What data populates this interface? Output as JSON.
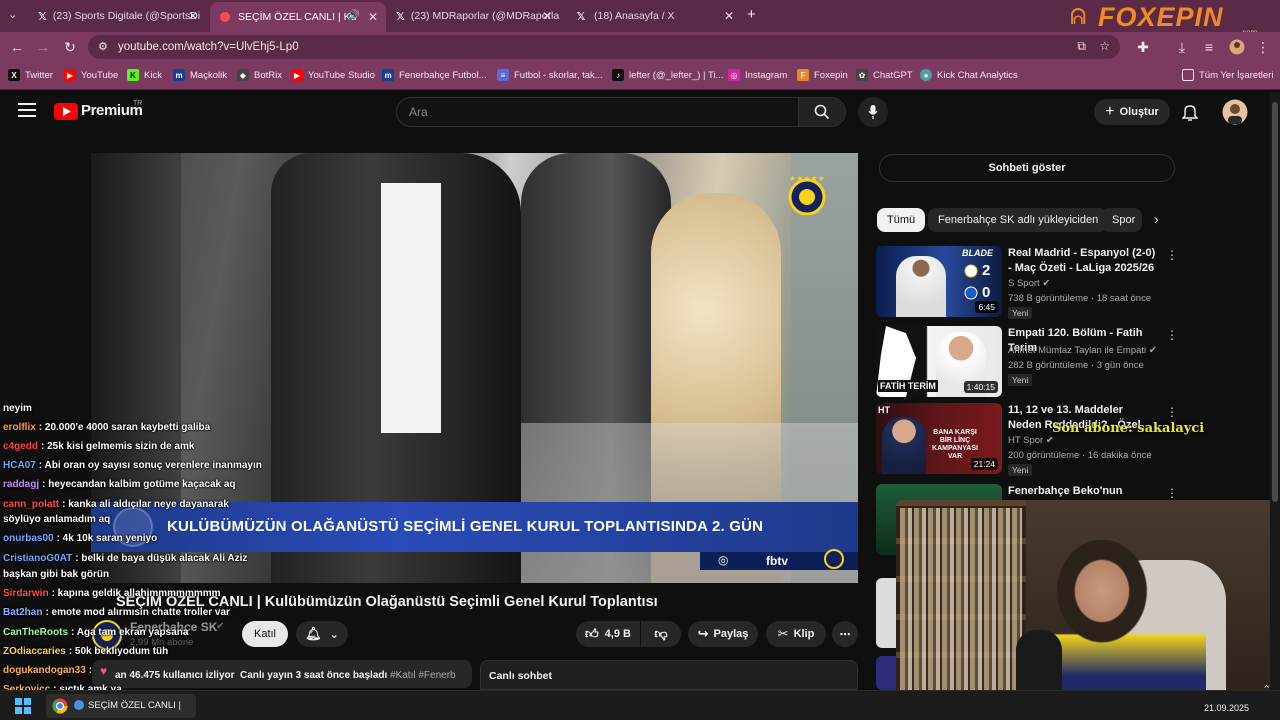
{
  "browser": {
    "tabs": [
      {
        "label": "(23) Sports Digitale (@SportsDi",
        "icon": "X",
        "active": false
      },
      {
        "label": "SEÇİM ÖZEL CANLI | Ku",
        "icon": "yt",
        "active": true
      },
      {
        "label": "(23) MDRaporlar (@MDRaporlar",
        "icon": "X",
        "active": false
      },
      {
        "label": "(18) Anasayfa / X",
        "icon": "X",
        "active": false
      }
    ],
    "url": "youtube.com/watch?v=UlvEhj5-Lp0",
    "bookmarks": [
      {
        "label": "Twitter",
        "color": "#111111",
        "glyph": "X"
      },
      {
        "label": "YouTube",
        "color": "#ff0000",
        "glyph": "▶"
      },
      {
        "label": "Kick",
        "color": "#53fc18",
        "glyph": "K"
      },
      {
        "label": "Maçkolik",
        "color": "#1a3d8f",
        "glyph": "m"
      },
      {
        "label": "BotRix",
        "color": "#444444",
        "glyph": "◆"
      },
      {
        "label": "YouTube Studio",
        "color": "#ff0000",
        "glyph": "▶"
      },
      {
        "label": "Fenerbahçe Futbol...",
        "color": "#1a3d8f",
        "glyph": "m"
      },
      {
        "label": "Futbol - skorlar, tak...",
        "color": "#5a6bd8",
        "glyph": "≡"
      },
      {
        "label": "lefter (@_lefter_) | Ti...",
        "color": "#111111",
        "glyph": "♪"
      },
      {
        "label": "Instagram",
        "color": "#d6249f",
        "glyph": "◎"
      },
      {
        "label": "Foxepin",
        "color": "#e8862a",
        "glyph": "F"
      },
      {
        "label": "ChatGPT",
        "color": "#444444",
        "glyph": "✿"
      },
      {
        "label": "Kick Chat Analytics",
        "color": "#4aa3a3",
        "glyph": "●"
      }
    ],
    "all_bookmarks": "Tüm Yer İşaretleri",
    "brand_overlay": "FOXEPIN",
    "brand_overlay_sub": ".com"
  },
  "youtube": {
    "logo_text": "Premium",
    "logo_region": "TR",
    "search_placeholder": "Ara",
    "create_label": "Oluştur",
    "video": {
      "lower_third": "KULÜBÜMÜZÜN OLAĞANÜSTÜ SEÇİMLİ GENEL KURUL TOPLANTISINDA 2. GÜN",
      "fbtv": "fbtv",
      "title": "SEÇİM ÖZEL CANLI | Kulübümüzün Olağanüstü Seçimli Genel Kurul Toplantısı",
      "channel": "Fenerbahçe SK",
      "subscribers": "2,99 Mn abone",
      "join_label": "Katıl",
      "likes": "4,9 B",
      "share_label": "Paylaş",
      "clip_label": "Klip",
      "viewers": "an 46.475 kullanıcı izliyor",
      "started": "Canlı yayın 3 saat önce başladı",
      "hashtags": "#Katıl #Fenerb",
      "live_chat": "Canlı sohbet"
    },
    "sidebar": {
      "show_chat": "Sohbeti göster",
      "chips": [
        "Tümü",
        "Fenerbahçe SK adlı yükleyiciden",
        "Spor"
      ],
      "videos": [
        {
          "title": "Real Madrid - Espanyol (2-0) - Maç Özeti - LaLiga 2025/26",
          "channel": "S Sport",
          "meta": "738 B görüntüleme · 18 saat önce",
          "badge": "Yeni",
          "duration": "6:45",
          "thumb_text": "BLADE",
          "score": "2 0"
        },
        {
          "title": "Empati 120. Bölüm - Fatih Terim",
          "channel": "Ahmet Mümtaz Taylan ile Empati",
          "meta": "282 B görüntüleme · 3 gün önce",
          "badge": "Yeni",
          "duration": "1:40:15",
          "thumb_text": "FATİH TERİM"
        },
        {
          "title": "11, 12 ve 13. Maddeler Neden Reddedildi? - Özel Röportaj",
          "channel": "HT Spor",
          "meta": "200 görüntüleme · 16 dakika önce",
          "badge": "Yeni",
          "duration": "21:24",
          "thumb_text": "BANA KARŞI BİR LİNÇ KAMPANYASI VAR"
        },
        {
          "title": "Fenerbahçe Beko'nun Medya",
          "channel": "",
          "meta": "",
          "badge": "",
          "duration": "",
          "thumb_text": ""
        }
      ]
    },
    "sub_alert": "Son abone: sakalayci"
  },
  "chat": [
    {
      "user": "",
      "text": "neyim",
      "color": "#ffffff"
    },
    {
      "user": "erolflix",
      "text": ": 20.000'e 4000 saran kaybetti galiba",
      "color": "#ff9a3c"
    },
    {
      "user": "c4gedd",
      "text": ": 25k kisi gelmemis sizin de amk",
      "color": "#ff4d4d"
    },
    {
      "user": "HCA07",
      "text": ": Abi oran oy sayısı sonuç verenlere inanmayın",
      "color": "#6aa9ff"
    },
    {
      "user": "raddagj",
      "text": ": heyecandan kalbim gotüme kaçacak aq",
      "color": "#c98aff"
    },
    {
      "user": "cann_polatt",
      "text": ": kanka ali aldıçılar neye dayanarak",
      "color": "#ff4d4d"
    },
    {
      "user": "",
      "text": "söylüyo anlamadım aq",
      "color": "#ffffff"
    },
    {
      "user": "onurbas00",
      "text": ": 4k 10k saran yeniyo",
      "color": "#6aa9ff"
    },
    {
      "user": "CristianoG0AT",
      "text": ": belki de baya düşük alacak Ali Aziz",
      "color": "#6aa9ff"
    },
    {
      "user": "",
      "text": "başkan gibi bak görün",
      "color": "#ffffff"
    },
    {
      "user": "Sirdarwin",
      "text": ": kapına geldik allahimmmmmmmm",
      "color": "#ff4d4d"
    },
    {
      "user": "Bat2han",
      "text": ": emote mod alırmısın chatte troller var",
      "color": "#8ab4ff"
    },
    {
      "user": "CanTheRoots",
      "text": ": Aga tam ekran yapsana",
      "color": "#9dff9d"
    },
    {
      "user": "ZOdiaccaries",
      "text": ": 50k bekliyodum tüh",
      "color": "#ffd24d"
    },
    {
      "user": "dogukandogan33",
      "text": ":",
      "color": "#ffb04d"
    },
    {
      "user": "Serkovicc",
      "text": ": sıçtık amk ya",
      "color": "#ffb04d"
    }
  ],
  "taskbar": {
    "window_label": "SEÇİM ÖZEL CANLI |",
    "date": "21.09.2025"
  }
}
